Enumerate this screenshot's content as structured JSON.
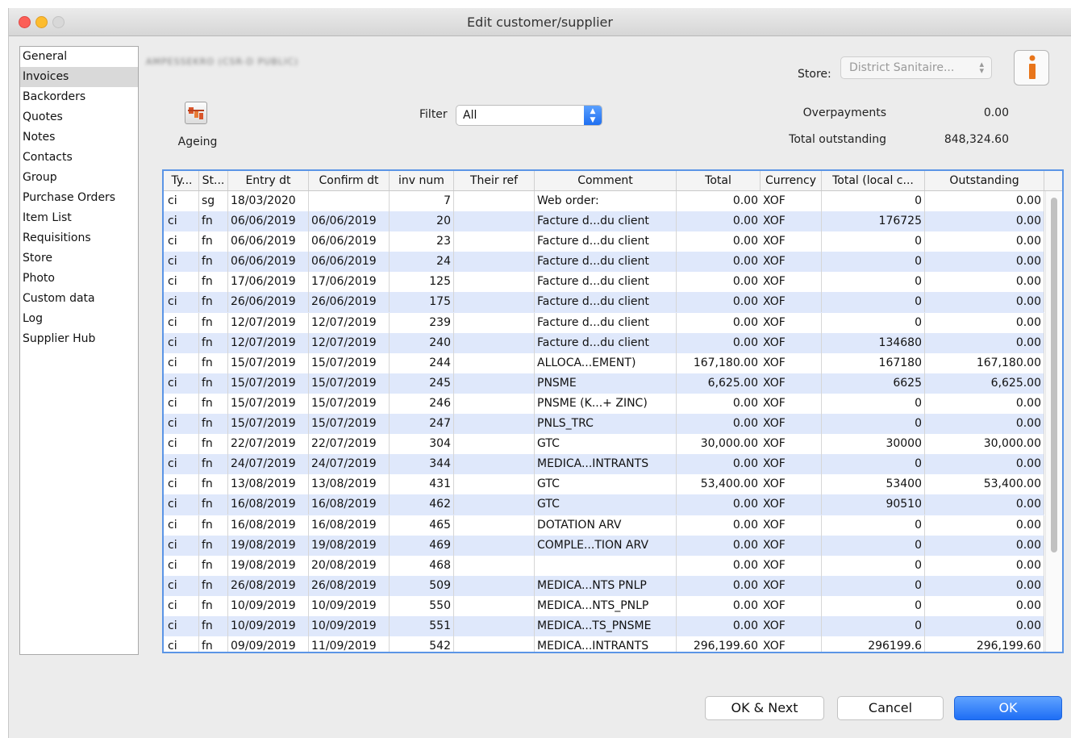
{
  "window": {
    "title": "Edit customer/supplier"
  },
  "sidebar": {
    "items": [
      "General",
      "Invoices",
      "Backorders",
      "Quotes",
      "Notes",
      "Contacts",
      "Group",
      "Purchase Orders",
      "Item List",
      "Requisitions",
      "Store",
      "Photo",
      "Custom data",
      "Log",
      "Supplier Hub"
    ],
    "selected": 1
  },
  "header": {
    "customer_name": "AMPESSEKRO (CSR-D PUBLIC)",
    "store_label": "Store:",
    "store_value": "District Sanitaire...",
    "info_icon": "info-icon",
    "ageing_label": "Ageing",
    "ageing_icon": "ageing-chart-icon",
    "filter_label": "Filter",
    "filter_value": "All",
    "overpayments_label": "Overpayments",
    "overpayments_value": "0.00",
    "outstanding_label": "Total outstanding",
    "outstanding_value": "848,324.60"
  },
  "table": {
    "columns": [
      "Ty...",
      "St...",
      "Entry dt",
      "Confirm dt",
      "inv num",
      "Their ref",
      "Comment",
      "Total",
      "Currency",
      "Total (local c...",
      "Outstanding"
    ],
    "rows": [
      [
        "ci",
        "sg",
        "18/03/2020",
        "",
        "7",
        "",
        "Web order:",
        "0.00",
        "XOF",
        "0",
        "0.00"
      ],
      [
        "ci",
        "fn",
        "06/06/2019",
        "06/06/2019",
        "20",
        "",
        "Facture d...du client",
        "0.00",
        "XOF",
        "176725",
        "0.00"
      ],
      [
        "ci",
        "fn",
        "06/06/2019",
        "06/06/2019",
        "23",
        "",
        "Facture d...du client",
        "0.00",
        "XOF",
        "0",
        "0.00"
      ],
      [
        "ci",
        "fn",
        "06/06/2019",
        "06/06/2019",
        "24",
        "",
        "Facture d...du client",
        "0.00",
        "XOF",
        "0",
        "0.00"
      ],
      [
        "ci",
        "fn",
        "17/06/2019",
        "17/06/2019",
        "125",
        "",
        "Facture d...du client",
        "0.00",
        "XOF",
        "0",
        "0.00"
      ],
      [
        "ci",
        "fn",
        "26/06/2019",
        "26/06/2019",
        "175",
        "",
        "Facture d...du client",
        "0.00",
        "XOF",
        "0",
        "0.00"
      ],
      [
        "ci",
        "fn",
        "12/07/2019",
        "12/07/2019",
        "239",
        "",
        "Facture d...du client",
        "0.00",
        "XOF",
        "0",
        "0.00"
      ],
      [
        "ci",
        "fn",
        "12/07/2019",
        "12/07/2019",
        "240",
        "",
        "Facture d...du client",
        "0.00",
        "XOF",
        "134680",
        "0.00"
      ],
      [
        "ci",
        "fn",
        "15/07/2019",
        "15/07/2019",
        "244",
        "",
        "ALLOCA...EMENT)",
        "167,180.00",
        "XOF",
        "167180",
        "167,180.00"
      ],
      [
        "ci",
        "fn",
        "15/07/2019",
        "15/07/2019",
        "245",
        "",
        "PNSME",
        "6,625.00",
        "XOF",
        "6625",
        "6,625.00"
      ],
      [
        "ci",
        "fn",
        "15/07/2019",
        "15/07/2019",
        "246",
        "",
        "PNSME (K...+ ZINC)",
        "0.00",
        "XOF",
        "0",
        "0.00"
      ],
      [
        "ci",
        "fn",
        "15/07/2019",
        "15/07/2019",
        "247",
        "",
        "PNLS_TRC",
        "0.00",
        "XOF",
        "0",
        "0.00"
      ],
      [
        "ci",
        "fn",
        "22/07/2019",
        "22/07/2019",
        "304",
        "",
        "GTC",
        "30,000.00",
        "XOF",
        "30000",
        "30,000.00"
      ],
      [
        "ci",
        "fn",
        "24/07/2019",
        "24/07/2019",
        "344",
        "",
        "MEDICA...INTRANTS",
        "0.00",
        "XOF",
        "0",
        "0.00"
      ],
      [
        "ci",
        "fn",
        "13/08/2019",
        "13/08/2019",
        "431",
        "",
        "GTC",
        "53,400.00",
        "XOF",
        "53400",
        "53,400.00"
      ],
      [
        "ci",
        "fn",
        "16/08/2019",
        "16/08/2019",
        "462",
        "",
        "GTC",
        "0.00",
        "XOF",
        "90510",
        "0.00"
      ],
      [
        "ci",
        "fn",
        "16/08/2019",
        "16/08/2019",
        "465",
        "",
        "DOTATION ARV",
        "0.00",
        "XOF",
        "0",
        "0.00"
      ],
      [
        "ci",
        "fn",
        "19/08/2019",
        "19/08/2019",
        "469",
        "",
        "COMPLE...TION ARV",
        "0.00",
        "XOF",
        "0",
        "0.00"
      ],
      [
        "ci",
        "fn",
        "19/08/2019",
        "20/08/2019",
        "468",
        "",
        "",
        "0.00",
        "XOF",
        "0",
        "0.00"
      ],
      [
        "ci",
        "fn",
        "26/08/2019",
        "26/08/2019",
        "509",
        "",
        "MEDICA...NTS PNLP",
        "0.00",
        "XOF",
        "0",
        "0.00"
      ],
      [
        "ci",
        "fn",
        "10/09/2019",
        "10/09/2019",
        "550",
        "",
        "MEDICA...NTS_PNLP",
        "0.00",
        "XOF",
        "0",
        "0.00"
      ],
      [
        "ci",
        "fn",
        "10/09/2019",
        "10/09/2019",
        "551",
        "",
        "MEDICA...TS_PNSME",
        "0.00",
        "XOF",
        "0",
        "0.00"
      ],
      [
        "ci",
        "fn",
        "09/09/2019",
        "11/09/2019",
        "542",
        "",
        "MEDICA...INTRANTS",
        "296,199.60",
        "XOF",
        "296199.6",
        "296,199.60"
      ]
    ]
  },
  "buttons": {
    "ok_next": "OK & Next",
    "cancel": "Cancel",
    "ok": "OK"
  },
  "colors": {
    "accent": "#1e6ef5",
    "row_alt": "#dfe8fb",
    "grid_border": "#5b95e6"
  }
}
